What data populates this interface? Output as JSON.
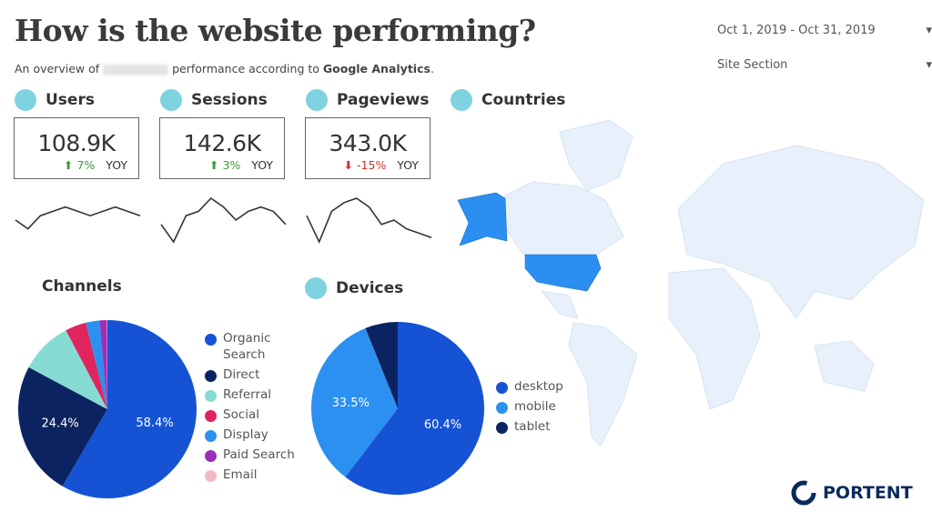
{
  "header": {
    "title": "How is the website performing?",
    "subtitle_prefix": "An overview of",
    "subtitle_mid": "performance according to",
    "subtitle_brand": "Google Analytics",
    "subtitle_end": "."
  },
  "controls": {
    "date_range": "Oct 1, 2019 - Oct 31, 2019",
    "site_section": "Site Section"
  },
  "metrics": [
    {
      "label": "Users",
      "value": "108.9K",
      "change": "7%",
      "direction": "up",
      "suffix": "YOY",
      "sparkline": [
        5,
        3,
        6,
        7,
        8,
        7,
        6,
        7,
        8,
        7,
        6
      ]
    },
    {
      "label": "Sessions",
      "value": "142.6K",
      "change": "3%",
      "direction": "up",
      "suffix": "YOY",
      "sparkline": [
        4,
        0,
        6,
        7,
        10,
        8,
        5,
        7,
        8,
        7,
        4
      ]
    },
    {
      "label": "Pageviews",
      "value": "343.0K",
      "change": "-15%",
      "direction": "down",
      "suffix": "YOY",
      "sparkline": [
        6,
        0,
        7,
        9,
        10,
        8,
        4,
        5,
        3,
        2,
        1
      ]
    }
  ],
  "countries": {
    "label": "Countries",
    "highlight_color": "#2b8ef0",
    "base_color": "#e8f1fb"
  },
  "chart_data": [
    {
      "type": "pie",
      "title": "Channels",
      "categories": [
        "Organic Search",
        "Direct",
        "Referral",
        "Social",
        "Display",
        "Paid Search",
        "Email"
      ],
      "values": [
        58.4,
        24.4,
        9.5,
        3.8,
        2.5,
        1.3,
        0.1
      ],
      "colors": [
        "#1553d4",
        "#0b2461",
        "#86dbd2",
        "#e0245e",
        "#2c90f0",
        "#9b2fb5",
        "#f4b9c6"
      ],
      "data_labels": [
        "58.4%",
        "24.4%"
      ],
      "legend": "right"
    },
    {
      "type": "pie",
      "title": "Devices",
      "categories": [
        "desktop",
        "mobile",
        "tablet"
      ],
      "values": [
        60.4,
        33.5,
        6.1
      ],
      "colors": [
        "#1553d4",
        "#2c90f0",
        "#0b2461"
      ],
      "data_labels": [
        "60.4%",
        "33.5%"
      ],
      "legend": "right"
    }
  ],
  "logo": {
    "text": "PORTENT"
  }
}
